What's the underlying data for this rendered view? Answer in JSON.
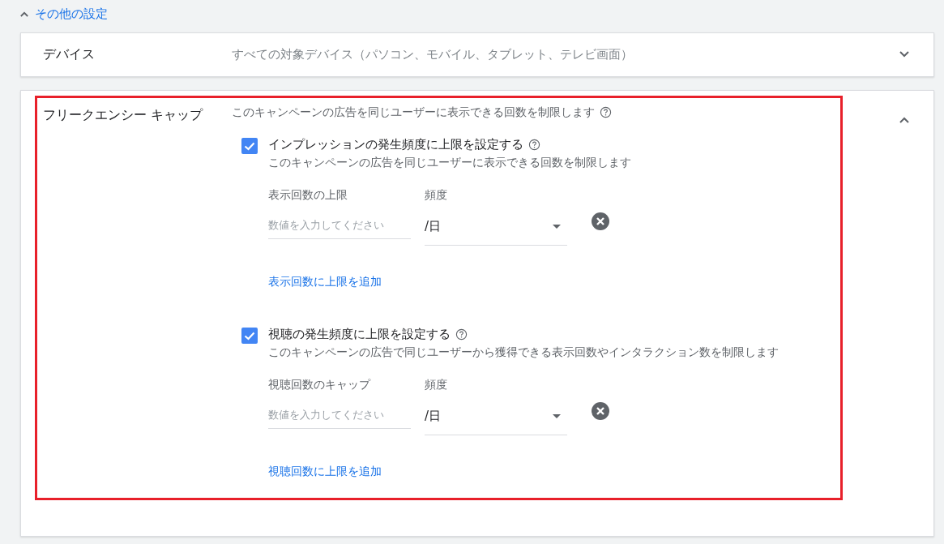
{
  "more_settings": {
    "label": "その他の設定",
    "expanded": true
  },
  "devices": {
    "label": "デバイス",
    "value": "すべての対象デバイス（パソコン、モバイル、タブレット、テレビ画面）",
    "expanded": false
  },
  "frequency_cap": {
    "label": "フリークエンシー キャップ",
    "description": "このキャンペーンの広告を同じユーザーに表示できる回数を制限します",
    "expanded": true,
    "highlighted": true,
    "caps": [
      {
        "checked": true,
        "title": "インプレッションの発生頻度に上限を設定する",
        "description": "このキャンペーンの広告を同じユーザーに表示できる回数を制限します",
        "limit_label": "表示回数の上限",
        "placeholder": "数値を入力してください",
        "frequency_label": "頻度",
        "frequency_value": "/日",
        "add_link": "表示回数に上限を追加"
      },
      {
        "checked": true,
        "title": "視聴の発生頻度に上限を設定する",
        "description": "このキャンペーンの広告で同じユーザーから獲得できる表示回数やインタラクション数を制限します",
        "limit_label": "視聴回数のキャップ",
        "placeholder": "数値を入力してください",
        "frequency_label": "頻度",
        "frequency_value": "/日",
        "add_link": "視聴回数に上限を追加"
      }
    ]
  }
}
